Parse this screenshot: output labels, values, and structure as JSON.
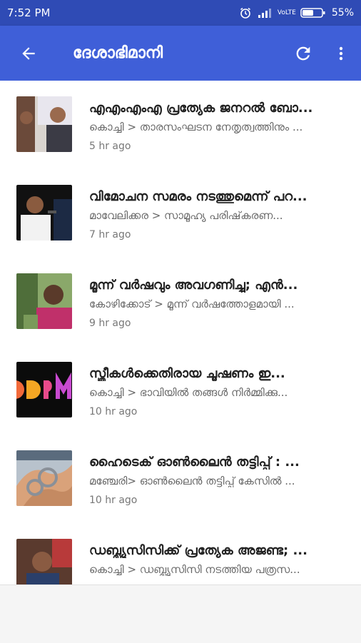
{
  "status": {
    "time": "7:52 PM",
    "network": "VoLTE",
    "battery": "55%"
  },
  "app_bar": {
    "title": "ദേശാഭിമാനി"
  },
  "news": [
    {
      "title": "എഎംഎംഎ പ്രത്യേക ജനറൽ ബോ...",
      "snippet": "കൊച്ചി > താരസംഘടന നേതൃത്വത്തിനും ...",
      "time": "5 hr ago"
    },
    {
      "title": "വിമോചന സമരം നടത്തുമെന്ന് പറ...",
      "snippet": "മാവേലിക്കര > സാമൂഹ്യ പരിഷ്‌കരണ...",
      "time": "7 hr ago"
    },
    {
      "title": "മൂന്ന് വർഷവും അവഗണിച്ചു; എൻ...",
      "snippet": "കോഴിക്കോട് > മൂന്ന് വർഷത്തോളമായി ...",
      "time": "9 hr ago"
    },
    {
      "title": "സ്ത്രീകൾക്കെതിരായ ചൂഷണം ഇ...",
      "snippet": "കൊച്ചി > ഭാവിയിൽ തങ്ങൾ നിർമ്മിക്കു...",
      "time": "10 hr ago"
    },
    {
      "title": "ഹൈടെക് ഓൺലൈൻ തട്ടിപ്പ് : ...",
      "snippet": "മഞ്ചേരി> ഓൺലൈൻ തട്ടിപ്പ് കേസിൽ ...",
      "time": "10 hr ago"
    },
    {
      "title": "ഡബ്ല്യുസിസിക്ക് പ്രത്യേക അജണ്ട; ...",
      "snippet": "കൊച്ചി > ഡബ്ല്യുസിസി നടത്തിയ പത്രസ...",
      "time": ""
    }
  ]
}
